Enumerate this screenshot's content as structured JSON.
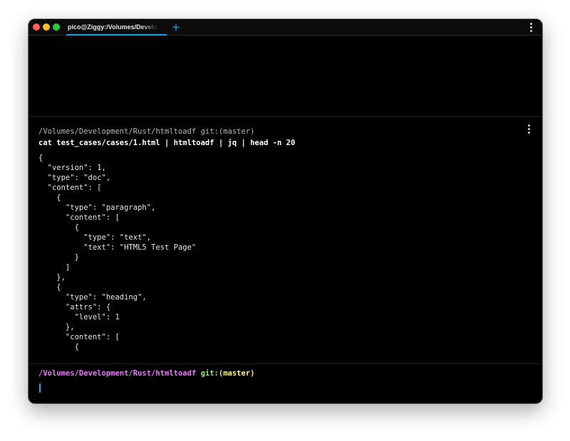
{
  "window": {
    "tab_title": "pico@Ziggy:/Volumes/Development/Rust/htmltoadf",
    "new_tab_symbol": "+",
    "accent_color": "#19a5e5",
    "traffic_lights": [
      "#ff5f57",
      "#febc2e",
      "#28c840"
    ]
  },
  "block": {
    "path": "/Volumes/Development/Rust/htmltoadf git:(master)",
    "command": "cat test_cases/cases/1.html | htmltoadf | jq | head -n 20",
    "output": [
      "{",
      "  \"version\": 1,",
      "  \"type\": \"doc\",",
      "  \"content\": [",
      "    {",
      "      \"type\": \"paragraph\",",
      "      \"content\": [",
      "        {",
      "          \"type\": \"text\",",
      "          \"text\": \"HTML5 Test Page\"",
      "        }",
      "      ]",
      "    },",
      "    {",
      "      \"type\": \"heading\",",
      "      \"attrs\": {",
      "        \"level\": 1",
      "      },",
      "      \"content\": [",
      "        {"
    ]
  },
  "prompt": {
    "path": "/Volumes/Development/Rust/htmltoadf",
    "git_label": " git:",
    "branch": "(master)",
    "path_color": "#e879f9",
    "git_color": "#9be57a",
    "branch_color": "#fff27d"
  },
  "icons": {
    "title_menu": "more-vertical-icon",
    "block_menu": "more-vertical-icon",
    "new_tab": "plus-icon"
  }
}
